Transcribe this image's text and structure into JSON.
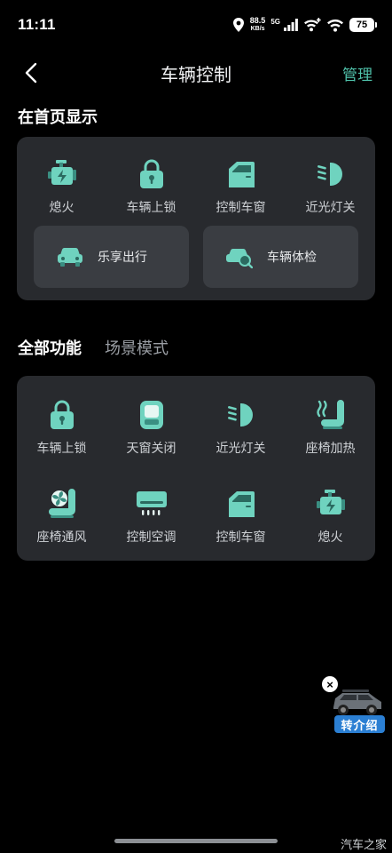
{
  "status_bar": {
    "time": "11:11",
    "net_speed_value": "88.5",
    "net_speed_unit": "KB/s",
    "net_type": "5G",
    "battery": "75"
  },
  "nav": {
    "title": "车辆控制",
    "manage_label": "管理"
  },
  "home_section": {
    "title": "在首页显示",
    "items": [
      {
        "label": "熄火",
        "icon": "engine-icon"
      },
      {
        "label": "车辆上锁",
        "icon": "lock-icon"
      },
      {
        "label": "控制车窗",
        "icon": "car-window-icon"
      },
      {
        "label": "近光灯关",
        "icon": "low-beam-icon"
      }
    ],
    "tiles": [
      {
        "label": "乐享出行",
        "icon": "car-front-icon"
      },
      {
        "label": "车辆体检",
        "icon": "car-check-icon"
      }
    ]
  },
  "tabs": {
    "active": "全部功能",
    "inactive": "场景模式"
  },
  "all_functions": {
    "row1": [
      {
        "label": "车辆上锁",
        "icon": "lock-icon"
      },
      {
        "label": "天窗关闭",
        "icon": "sunroof-icon"
      },
      {
        "label": "近光灯关",
        "icon": "low-beam-icon"
      },
      {
        "label": "座椅加热",
        "icon": "seat-heat-icon"
      }
    ],
    "row2": [
      {
        "label": "座椅通风",
        "icon": "seat-vent-icon"
      },
      {
        "label": "控制空调",
        "icon": "air-conditioner-icon"
      },
      {
        "label": "控制车窗",
        "icon": "car-window-icon"
      },
      {
        "label": "熄火",
        "icon": "engine-icon"
      }
    ]
  },
  "promo": {
    "badge_label": "转介绍",
    "close_symbol": "×"
  },
  "watermark": "汽车之家",
  "colors": {
    "background": "#000000",
    "panel": "#282a2e",
    "tile": "#3a3d42",
    "accent": "#4fc1aa",
    "icon_light": "#6fd3bf",
    "icon_dark": "#3a8f82"
  }
}
